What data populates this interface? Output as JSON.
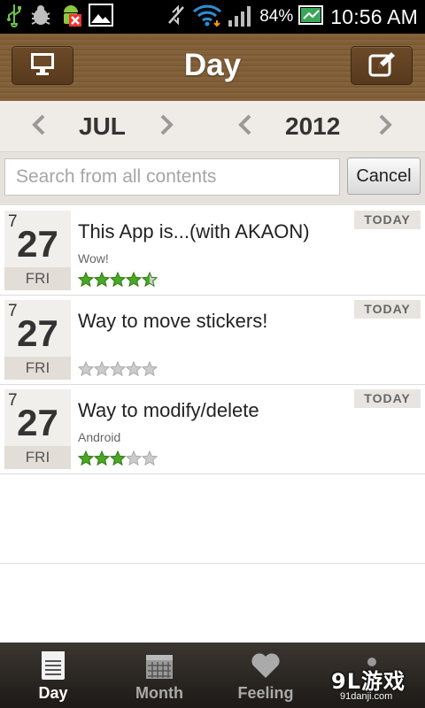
{
  "status_bar": {
    "battery_percent": "84%",
    "time": "10:56 AM",
    "icons": [
      "usb-icon",
      "bug-icon",
      "android-icon",
      "image-icon",
      "mute-icon",
      "wifi-icon",
      "signal-icon",
      "battery-icon"
    ]
  },
  "header": {
    "title": "Day",
    "left_icon": "monitor-icon",
    "right_icon": "edit-icon"
  },
  "selector": {
    "month": "JUL",
    "year": "2012"
  },
  "search": {
    "placeholder": "Search from all contents",
    "cancel_label": "Cancel"
  },
  "entries": [
    {
      "month": "7",
      "day": "27",
      "weekday": "FRI",
      "title": "This App is...(with AKAON)",
      "subtitle": "Wow!",
      "rating": 4.5,
      "badge": "TODAY"
    },
    {
      "month": "7",
      "day": "27",
      "weekday": "FRI",
      "title": "Way to move stickers!",
      "subtitle": "",
      "rating": 0,
      "badge": "TODAY"
    },
    {
      "month": "7",
      "day": "27",
      "weekday": "FRI",
      "title": "Way to modify/delete",
      "subtitle": "Android",
      "rating": 3,
      "badge": "TODAY"
    }
  ],
  "tabs": [
    {
      "label": "Day",
      "icon": "day-list-icon",
      "active": true
    },
    {
      "label": "Month",
      "icon": "calendar-icon",
      "active": false
    },
    {
      "label": "Feeling",
      "icon": "heart-icon",
      "active": false
    }
  ],
  "watermark": {
    "main": "9L游戏",
    "sub": "91danji.com"
  },
  "colors": {
    "wood": "#7b5a35",
    "star_active": "#4aa826",
    "star_inactive": "#cccccc"
  }
}
